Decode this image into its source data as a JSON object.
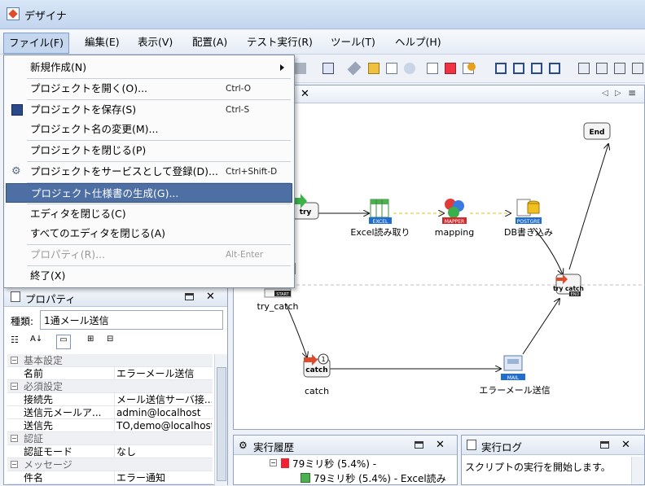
{
  "window": {
    "title": "デザイナ"
  },
  "menubar": {
    "items": [
      "ファイル(F)",
      "編集(E)",
      "表示(V)",
      "配置(A)",
      "テスト実行(R)",
      "ツール(T)",
      "ヘルプ(H)"
    ]
  },
  "file_menu": {
    "items": [
      {
        "label": "新規作成(N)",
        "shortcut": "",
        "submenu": true,
        "disabled": false,
        "highlighted": false
      },
      {
        "label": "プロジェクトを開く(O)...",
        "shortcut": "Ctrl-O",
        "disabled": false,
        "highlighted": false
      },
      {
        "label": "プロジェクトを保存(S)",
        "shortcut": "Ctrl-S",
        "disabled": false,
        "highlighted": false,
        "icon": "save-icon"
      },
      {
        "label": "プロジェクト名の変更(M)...",
        "shortcut": "",
        "disabled": false,
        "highlighted": false
      },
      {
        "label": "プロジェクトを閉じる(P)",
        "shortcut": "",
        "disabled": false,
        "highlighted": false
      },
      {
        "label": "プロジェクトをサービスとして登録(D)...",
        "shortcut": "Ctrl+Shift-D",
        "disabled": false,
        "highlighted": false,
        "icon": "gear-icon"
      },
      {
        "label": "プロジェクト仕様書の生成(G)...",
        "shortcut": "",
        "disabled": false,
        "highlighted": true
      },
      {
        "label": "エディタを閉じる(C)",
        "shortcut": "",
        "disabled": false,
        "highlighted": false
      },
      {
        "label": "すべてのエディタを閉じる(A)",
        "shortcut": "",
        "disabled": false,
        "highlighted": false
      },
      {
        "label": "プロパティ(R)...",
        "shortcut": "Alt-Enter",
        "disabled": true,
        "highlighted": false
      },
      {
        "label": "終了(X)",
        "shortcut": "",
        "disabled": false,
        "highlighted": false
      }
    ]
  },
  "editor": {
    "nodes": {
      "end": "End",
      "try": "try",
      "excel": {
        "badge": "EXCEL",
        "label": "Excel読み取り"
      },
      "mapping": {
        "badge": "MAPPER",
        "label": "mapping"
      },
      "db": {
        "badge": "POSTGRE",
        "label": "DB書き込み"
      },
      "try_catch_end": {
        "text": "try catch",
        "badge": "END"
      },
      "try_catch_start": {
        "badge": "START",
        "label": "try_catch"
      },
      "catch": {
        "text": "catch",
        "count": "1",
        "label": "catch"
      },
      "mail": {
        "badge": "MAIL",
        "label": "エラーメール送信"
      }
    }
  },
  "properties": {
    "title": "プロパティ",
    "type_label": "種類:",
    "type_value": "1通メール送信",
    "rows": [
      {
        "category": true,
        "key": "基本設定"
      },
      {
        "key": "名前",
        "value": "エラーメール送信"
      },
      {
        "category": true,
        "key": "必須設定"
      },
      {
        "key": "接続先",
        "value": "メール送信サーバ接..."
      },
      {
        "key": "送信元メールア...",
        "value": "admin@localhost"
      },
      {
        "key": "送信先",
        "value": "TO,demo@localhost"
      },
      {
        "category": true,
        "key": "認証"
      },
      {
        "key": "認証モード",
        "value": "なし"
      },
      {
        "category": true,
        "key": "メッセージ"
      },
      {
        "key": "件名",
        "value": "エラー通知"
      }
    ]
  },
  "history_panel": {
    "title": "実行履歴",
    "lines": [
      "79ミリ秒 (5.4%) -",
      "79ミリ秒 (5.4%) - Excel読み"
    ]
  },
  "log_panel": {
    "title": "実行ログ",
    "text": "スクリプトの実行を開始します。"
  }
}
